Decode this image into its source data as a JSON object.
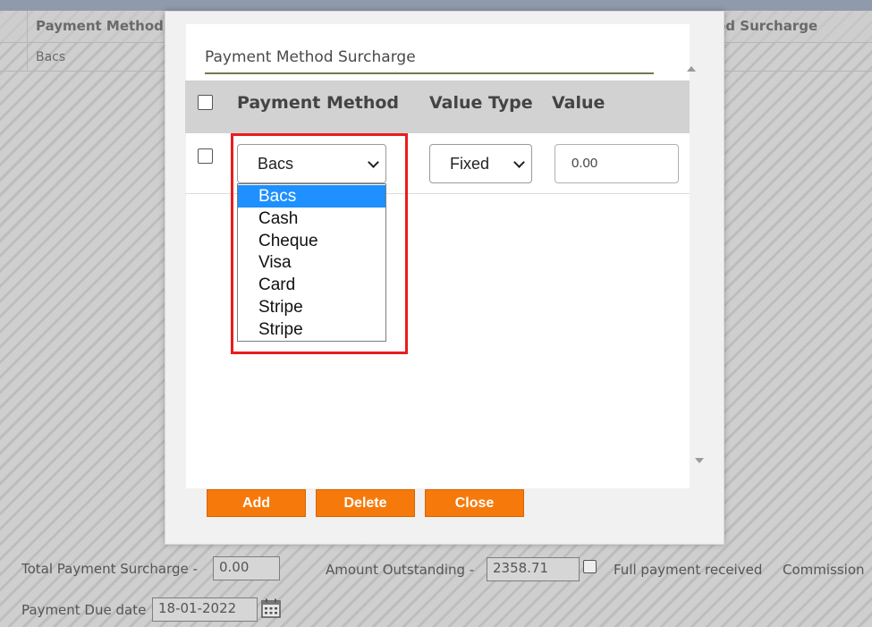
{
  "background": {
    "table": {
      "col_payment_method": "Payment Method",
      "col_surcharge_partial": "od Surcharge",
      "row_value": "Bacs"
    },
    "footer": {
      "total_surcharge_label": "Total Payment Surcharge -",
      "total_surcharge_value": "0.00",
      "amount_outstanding_label": "Amount Outstanding -",
      "amount_outstanding_value": "2358.71",
      "full_payment_label": "Full payment received",
      "commission_label": "Commission",
      "due_date_label": "Payment Due date",
      "due_date_value": "18-01-2022",
      "calendar_icon": "calendar-icon"
    }
  },
  "modal": {
    "title": "Payment Method Surcharge",
    "columns": [
      "Payment Method",
      "Value Type",
      "Value"
    ],
    "row": {
      "payment_method_selected": "Bacs",
      "value_type_selected": "Fixed",
      "value_placeholder": "0.00"
    },
    "dropdown_options": [
      "Bacs",
      "Cash",
      "Cheque",
      "Visa",
      "Card",
      "Stripe",
      "Stripe"
    ],
    "dropdown_selected_index": 0,
    "buttons": {
      "add": "Add",
      "delete": "Delete",
      "close": "Close"
    }
  },
  "colors": {
    "accent_orange": "#f57a0b",
    "highlight_red": "#ea1c1c",
    "selected_option_blue": "#1e90ff",
    "title_rule_olive": "#707a4e"
  }
}
